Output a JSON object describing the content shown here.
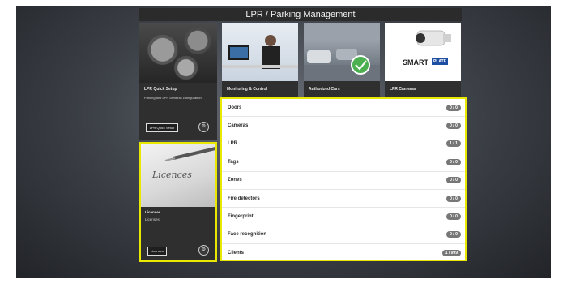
{
  "page_title": "LPR / Parking Management",
  "tiles": {
    "setup": {
      "title": "LPR Quick Setup",
      "description": "Parking and LPR cameras configuration",
      "button_label": "LPR Quick Setup"
    },
    "monitoring": {
      "title": "Monitoring & Control"
    },
    "cars": {
      "title": "Authorized Cars"
    },
    "cameras": {
      "title": "LPR Cameras",
      "brand": "SMART",
      "brand_badge": "PLATE"
    }
  },
  "licence_tile": {
    "image_word": "Licences",
    "title": "Licenses",
    "subtitle": "Licenses",
    "button_label": "Licenses"
  },
  "list_items": [
    {
      "label": "Doors",
      "count": "0 / 0"
    },
    {
      "label": "Cameras",
      "count": "0 / 0"
    },
    {
      "label": "LPR",
      "count": "1 / 1"
    },
    {
      "label": "Tags",
      "count": "0 / 0"
    },
    {
      "label": "Zones",
      "count": "0 / 0"
    },
    {
      "label": "Fire detectors",
      "count": "0 / 0"
    },
    {
      "label": "Fingerprint",
      "count": "0 / 0"
    },
    {
      "label": "Face recognition",
      "count": "0 / 0"
    },
    {
      "label": "Clients",
      "count": "1 / 999"
    }
  ],
  "colors": {
    "highlight": "#e8e800",
    "badge": "#777777"
  }
}
